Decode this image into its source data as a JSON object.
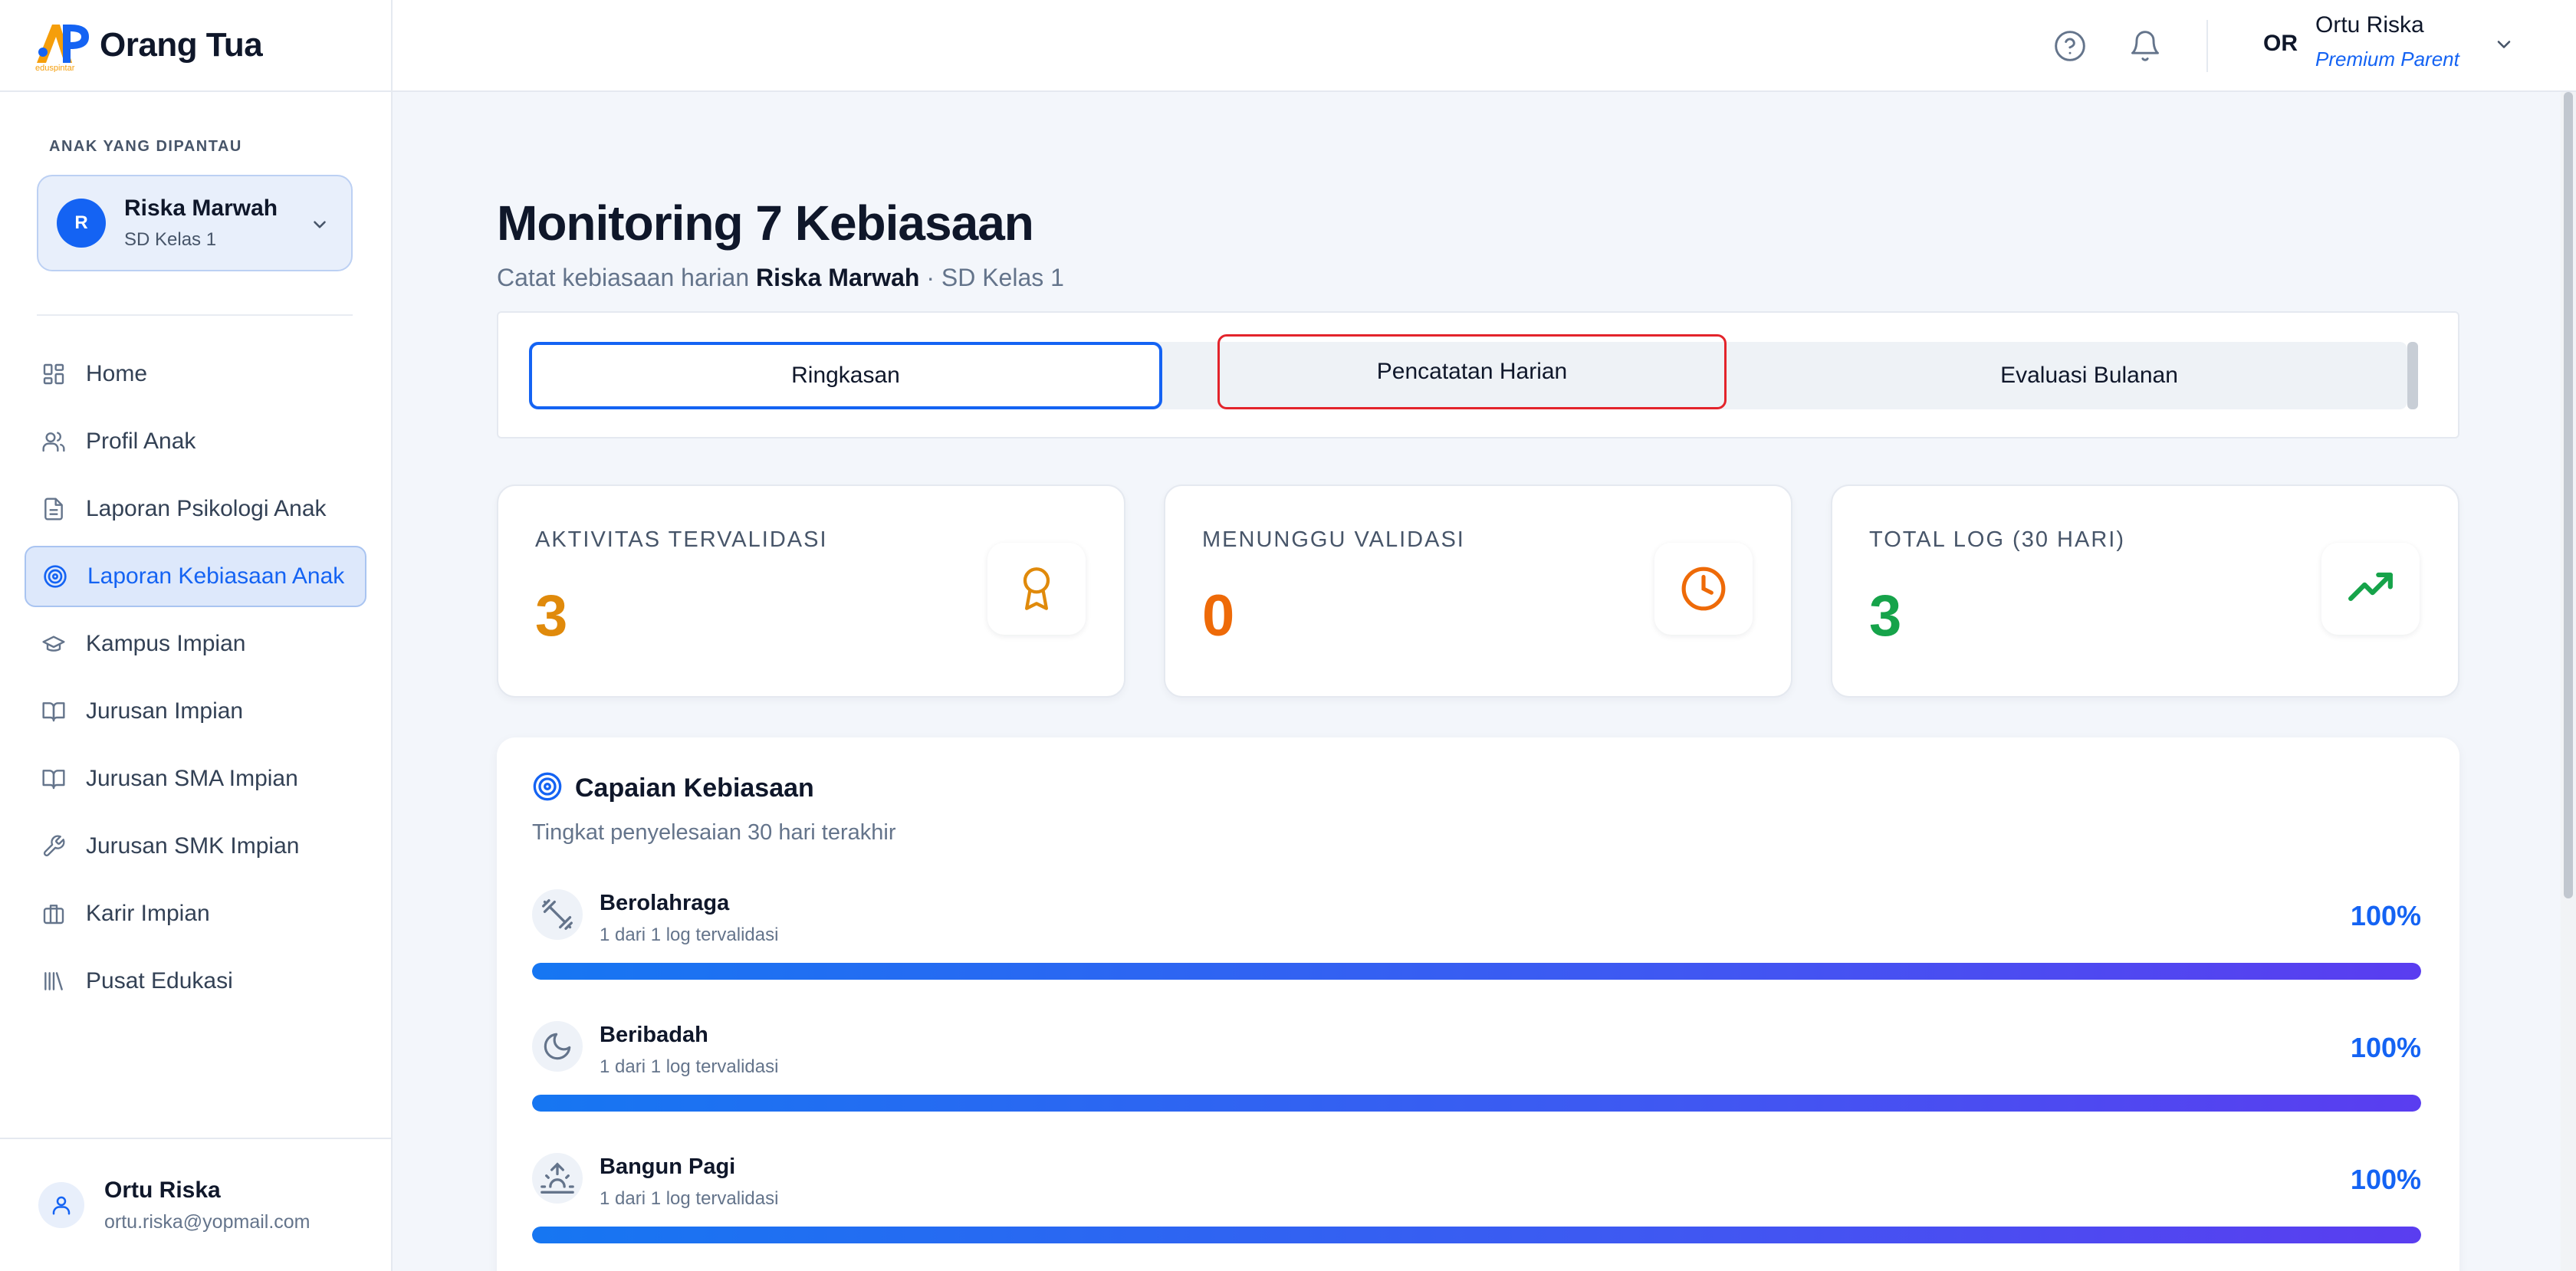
{
  "brand": {
    "title": "Orang Tua",
    "logo_text": "eduspintar"
  },
  "sidebar": {
    "child_section_label": "ANAK YANG DIPANTAU",
    "child": {
      "initial": "R",
      "name": "Riska Marwah",
      "grade": "SD Kelas 1"
    },
    "items": [
      {
        "label": "Home",
        "icon": "grid-icon"
      },
      {
        "label": "Profil Anak",
        "icon": "users-icon"
      },
      {
        "label": "Laporan Psikologi Anak",
        "icon": "document-icon"
      },
      {
        "label": "Laporan Kebiasaan Anak",
        "icon": "target-icon",
        "active": true
      },
      {
        "label": "Kampus Impian",
        "icon": "graduation-cap-icon"
      },
      {
        "label": "Jurusan Impian",
        "icon": "book-open-icon"
      },
      {
        "label": "Jurusan SMA Impian",
        "icon": "book-open-icon"
      },
      {
        "label": "Jurusan SMK Impian",
        "icon": "wrench-icon"
      },
      {
        "label": "Karir Impian",
        "icon": "briefcase-icon"
      },
      {
        "label": "Pusat Edukasi",
        "icon": "library-icon"
      }
    ],
    "footer": {
      "name": "Ortu Riska",
      "email": "ortu.riska@yopmail.com"
    }
  },
  "topbar": {
    "initials": "OR",
    "user_name": "Ortu Riska",
    "user_role": "Premium Parent"
  },
  "page": {
    "title": "Monitoring 7 Kebiasaan",
    "subtitle_prefix": "Catat kebiasaan harian",
    "subtitle_name": "Riska Marwah",
    "subtitle_suffix": "· SD Kelas 1"
  },
  "tabs": [
    {
      "label": "Ringkasan",
      "selected": true
    },
    {
      "label": "Pencatatan Harian"
    },
    {
      "label": "Evaluasi Bulanan"
    }
  ],
  "stats": [
    {
      "label": "AKTIVITAS TERVALIDASI",
      "value": "3",
      "color": "#e08a0b",
      "icon": "award-icon"
    },
    {
      "label": "MENUNGGU VALIDASI",
      "value": "0",
      "color": "#ee6a08",
      "icon": "clock-icon"
    },
    {
      "label": "TOTAL LOG (30 HARI)",
      "value": "3",
      "color": "#16a34a",
      "icon": "trending-up-icon"
    }
  ],
  "progress": {
    "title": "Capaian Kebiasaan",
    "subtitle": "Tingkat penyelesaian 30 hari terakhir",
    "habits": [
      {
        "name": "Berolahraga",
        "detail": "1 dari 1 log tervalidasi",
        "percent_label": "100%",
        "percent": 100,
        "icon": "dumbbell-icon"
      },
      {
        "name": "Beribadah",
        "detail": "1 dari 1 log tervalidasi",
        "percent_label": "100%",
        "percent": 100,
        "icon": "moon-icon"
      },
      {
        "name": "Bangun Pagi",
        "detail": "1 dari 1 log tervalidasi",
        "percent_label": "100%",
        "percent": 100,
        "icon": "sunrise-icon"
      }
    ]
  },
  "colors": {
    "accent": "#1463f3",
    "highlight_border": "#e3242b"
  }
}
